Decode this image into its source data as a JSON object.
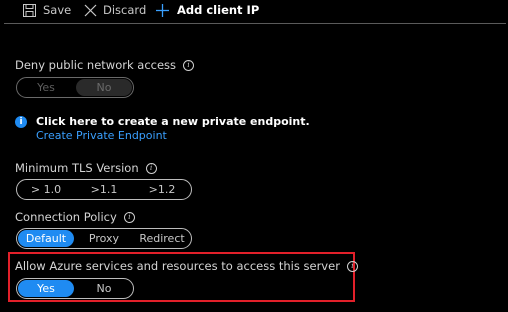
{
  "toolbar": {
    "save_label": "Save",
    "discard_label": "Discard",
    "add_client_ip_label": "Add client IP"
  },
  "deny_public_access": {
    "label": "Deny public network access",
    "options": [
      "Yes",
      "No"
    ],
    "selected": "No",
    "disabled": true
  },
  "private_endpoint": {
    "title": "Click here to create a new private endpoint.",
    "link": "Create Private Endpoint"
  },
  "min_tls": {
    "label": "Minimum TLS Version",
    "options": [
      "> 1.0",
      ">1.1",
      ">1.2"
    ],
    "selected": null
  },
  "connection_policy": {
    "label": "Connection Policy",
    "options": [
      "Default",
      "Proxy",
      "Redirect"
    ],
    "selected": "Default"
  },
  "allow_azure": {
    "label": "Allow Azure services and resources to access this server",
    "options": [
      "Yes",
      "No"
    ],
    "selected": "Yes"
  },
  "colors": {
    "accent": "#1f8bf2",
    "highlight_border": "#e2202a",
    "background": "#000000"
  }
}
